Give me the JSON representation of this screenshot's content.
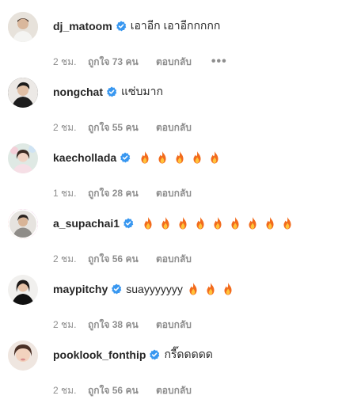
{
  "comments": [
    {
      "username": "dj_matoom",
      "text": "เอาอีก เอาอีกกกกก",
      "fire_count": 0,
      "time": "2 ชม.",
      "likes": "ถูกใจ 73 คน",
      "reply": "ตอบกลับ",
      "more": "•••"
    },
    {
      "username": "nongchat",
      "text": "แซ่บมาก",
      "fire_count": 0,
      "time": "2 ชม.",
      "likes": "ถูกใจ 55 คน",
      "reply": "ตอบกลับ"
    },
    {
      "username": "kaechollada",
      "text": "",
      "fire_count": 5,
      "time": "1 ชม.",
      "likes": "ถูกใจ 28 คน",
      "reply": "ตอบกลับ"
    },
    {
      "username": "a_supachai1",
      "text": "",
      "fire_count": 9,
      "time": "2 ชม.",
      "likes": "ถูกใจ 56 คน",
      "reply": "ตอบกลับ"
    },
    {
      "username": "maypitchy",
      "text": "suayyyyyyy",
      "fire_count": 3,
      "time": "2 ชม.",
      "likes": "ถูกใจ 38 คน",
      "reply": "ตอบกลับ"
    },
    {
      "username": "pooklook_fonthip",
      "text": "กรี๊ดดดดด",
      "fire_count": 0,
      "time": "2 ชม.",
      "likes": "ถูกใจ 56 คน",
      "reply": "ตอบกลับ"
    }
  ],
  "icons": {
    "verified": "verified-badge-icon",
    "fire": "fire-emoji-icon",
    "more": "more-options-icon"
  },
  "colors": {
    "verified_blue": "#3897f0",
    "meta_gray": "#8e8e8e",
    "text": "#262626",
    "story_ring": "#e1306c"
  }
}
